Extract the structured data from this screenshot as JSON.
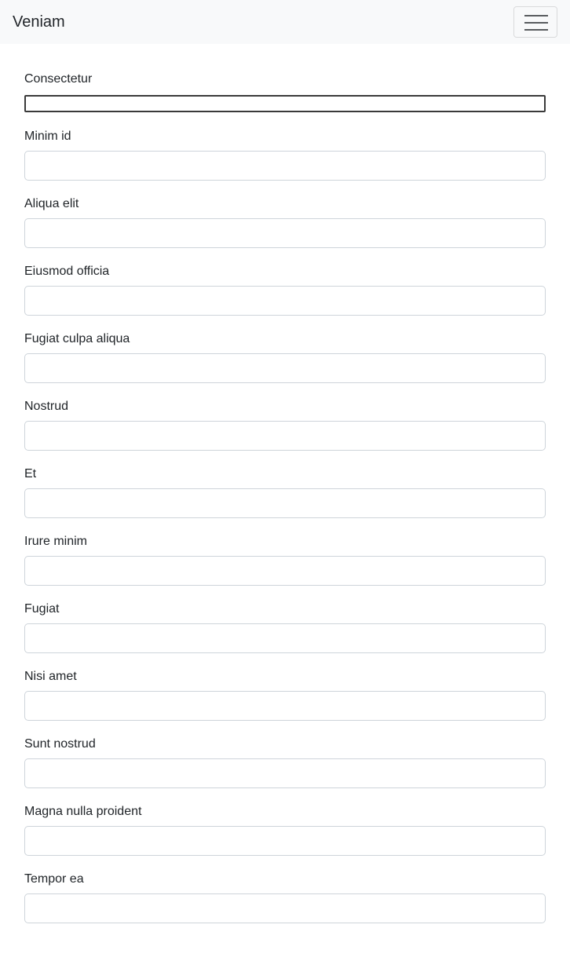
{
  "navbar": {
    "brand": "Veniam",
    "toggle_icon": "hamburger-menu-icon"
  },
  "form": {
    "fields": [
      {
        "label": "Consectetur",
        "value": "",
        "placeholder": ""
      },
      {
        "label": "Minim id",
        "value": "",
        "placeholder": ""
      },
      {
        "label": "Aliqua elit",
        "value": "",
        "placeholder": ""
      },
      {
        "label": "Eiusmod officia",
        "value": "",
        "placeholder": ""
      },
      {
        "label": "Fugiat culpa aliqua",
        "value": "",
        "placeholder": ""
      },
      {
        "label": "Nostrud",
        "value": "",
        "placeholder": ""
      },
      {
        "label": "Et",
        "value": "",
        "placeholder": ""
      },
      {
        "label": "Irure minim",
        "value": "",
        "placeholder": ""
      },
      {
        "label": "Fugiat",
        "value": "",
        "placeholder": ""
      },
      {
        "label": "Nisi amet",
        "value": "",
        "placeholder": ""
      },
      {
        "label": "Sunt nostrud",
        "value": "",
        "placeholder": ""
      },
      {
        "label": "Magna nulla proident",
        "value": "",
        "placeholder": ""
      },
      {
        "label": "Tempor ea",
        "value": "",
        "placeholder": ""
      }
    ]
  }
}
